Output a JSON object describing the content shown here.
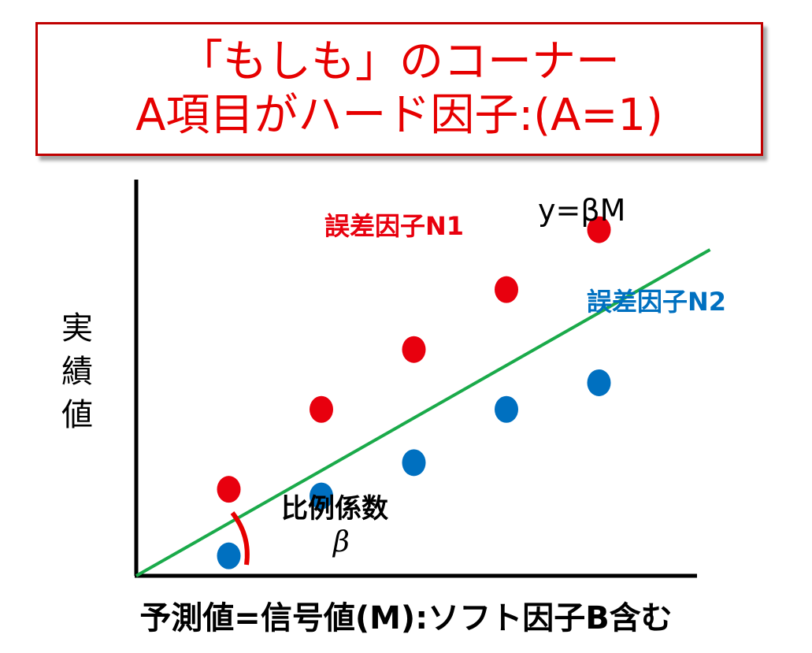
{
  "title": {
    "line1": "「もしも」のコーナー",
    "line2": "A項目がハード因子:(A=1)"
  },
  "axes": {
    "ylabel": "実績値",
    "xlabel": "予測値=信号値(M):ソフト因子B含む"
  },
  "annotations": {
    "equation": "y=βM",
    "coefficient_label": "比例係数",
    "coefficient_symbol": "β"
  },
  "colors": {
    "title": "#e60000",
    "n1": "#e8000e",
    "n2": "#0070c0",
    "line": "#1aaa4a",
    "arc": "#e60000"
  },
  "chart_data": {
    "type": "scatter",
    "series": [
      {
        "name": "誤差因子N1",
        "color": "#e8000e",
        "points": [
          [
            1,
            1.3
          ],
          [
            2,
            2.5
          ],
          [
            3,
            3.4
          ],
          [
            4,
            4.3
          ],
          [
            5,
            5.2
          ]
        ]
      },
      {
        "name": "誤差因子N2",
        "color": "#0070c0",
        "points": [
          [
            1,
            0.3
          ],
          [
            2,
            1.2
          ],
          [
            3,
            1.7
          ],
          [
            4,
            2.5
          ],
          [
            5,
            2.9
          ]
        ]
      }
    ],
    "line": {
      "label": "y=βM",
      "x": [
        0,
        6.2
      ],
      "y": [
        0,
        4.9
      ]
    },
    "xlim": [
      0,
      6.2
    ],
    "ylim": [
      0,
      5.6
    ],
    "grid": false
  }
}
